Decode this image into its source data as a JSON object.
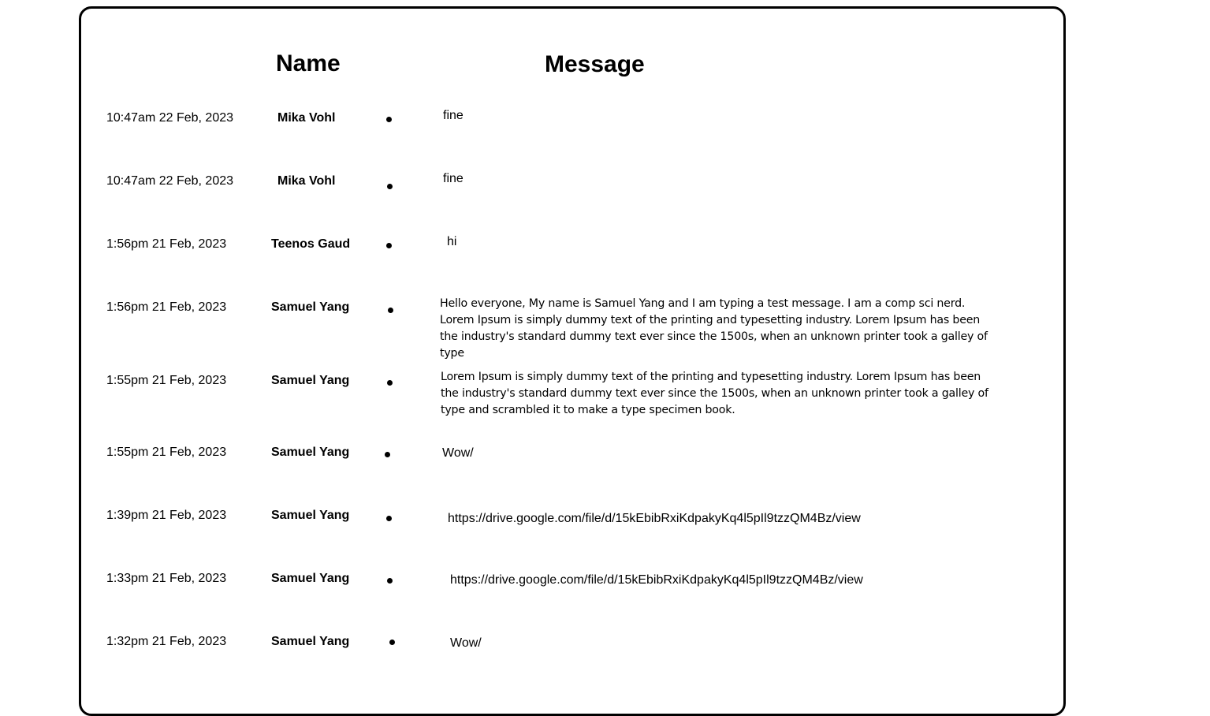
{
  "header": {
    "name_label": "Name",
    "message_label": "Message"
  },
  "messages": [
    {
      "time": "10:47am 22 Feb, 2023",
      "name": "Mika Vohl",
      "text": "fine"
    },
    {
      "time": "10:47am 22 Feb, 2023",
      "name": "Mika Vohl",
      "text": "fine"
    },
    {
      "time": "1:56pm 21 Feb, 2023",
      "name": "Teenos Gaud",
      "text": "hi"
    },
    {
      "time": "1:56pm 21 Feb, 2023",
      "name": "Samuel Yang",
      "text": "Hello everyone, My name is Samuel Yang and I am typing a test message. I am a comp sci nerd. Lorem Ipsum is simply dummy text of the printing and typesetting industry. Lorem Ipsum has been the industry's standard dummy text ever since the 1500s, when an unknown printer took a galley of type"
    },
    {
      "time": "1:55pm 21 Feb, 2023",
      "name": "Samuel Yang",
      "text": "Lorem Ipsum is simply dummy text of the printing and typesetting industry. Lorem Ipsum has been the industry's standard dummy text ever since the 1500s, when an unknown printer took a galley of type and scrambled it to make a type specimen book."
    },
    {
      "time": "1:55pm 21 Feb, 2023",
      "name": "Samuel Yang",
      "text": "Wow/"
    },
    {
      "time": "1:39pm 21 Feb, 2023",
      "name": "Samuel Yang",
      "text": "https://drive.google.com/file/d/15kEbibRxiKdpakyKq4l5pIl9tzzQM4Bz/view"
    },
    {
      "time": "1:33pm 21 Feb, 2023",
      "name": "Samuel Yang",
      "text": "https://drive.google.com/file/d/15kEbibRxiKdpakyKq4l5pIl9tzzQM4Bz/view"
    },
    {
      "time": "1:32pm 21 Feb, 2023",
      "name": "Samuel Yang",
      "text": "Wow/"
    }
  ],
  "icons": {
    "row_separator": "bullet-dot-icon"
  }
}
